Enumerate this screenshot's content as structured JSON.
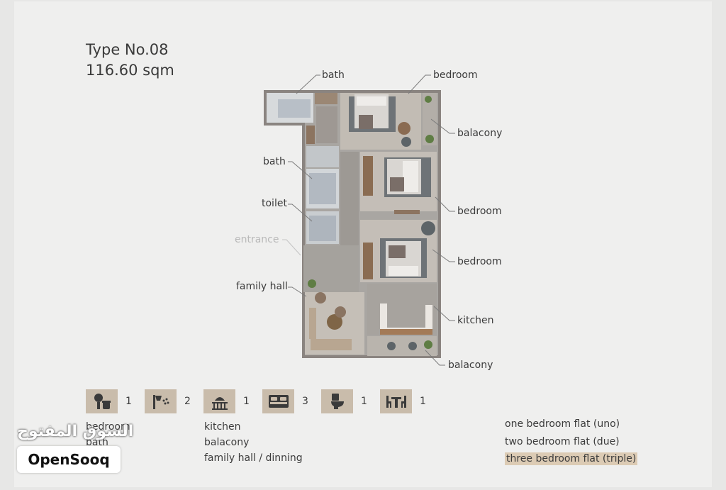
{
  "header": {
    "type_label": "Type No.08",
    "area": "116.60 sqm"
  },
  "plan_labels": {
    "bath_top": "bath",
    "bedroom_top": "bedroom",
    "balcony_top": "balacony",
    "bath_mid": "bath",
    "toilet": "toilet",
    "entrance": "entrance",
    "bedroom_mid": "bedroom",
    "bedroom_low": "bedroom",
    "family_hall": "family hall",
    "kitchen": "kitchen",
    "balcony_bottom": "balacony"
  },
  "stats": [
    {
      "icon": "kitchen-icon",
      "value": "1"
    },
    {
      "icon": "shower-icon",
      "value": "2"
    },
    {
      "icon": "balcony-icon",
      "value": "1"
    },
    {
      "icon": "bed-icon",
      "value": "3"
    },
    {
      "icon": "toilet-icon",
      "value": "1"
    },
    {
      "icon": "dining-table-icon",
      "value": "1"
    }
  ],
  "legend_left": [
    "bedroom",
    "bath"
  ],
  "legend_mid": [
    "kitchen",
    "balacony",
    "family hall / dinning"
  ],
  "flat_types": [
    "one bedroom flat (uno)",
    "two bedroom flat (due)",
    "three bedroom flat (triple)"
  ],
  "watermark": {
    "arabic": "السوق المفتوح",
    "brand": "OpenSooq"
  },
  "colors": {
    "accent_box": "#c9bcab",
    "highlight": "#dccbb4",
    "background": "#efefee"
  }
}
